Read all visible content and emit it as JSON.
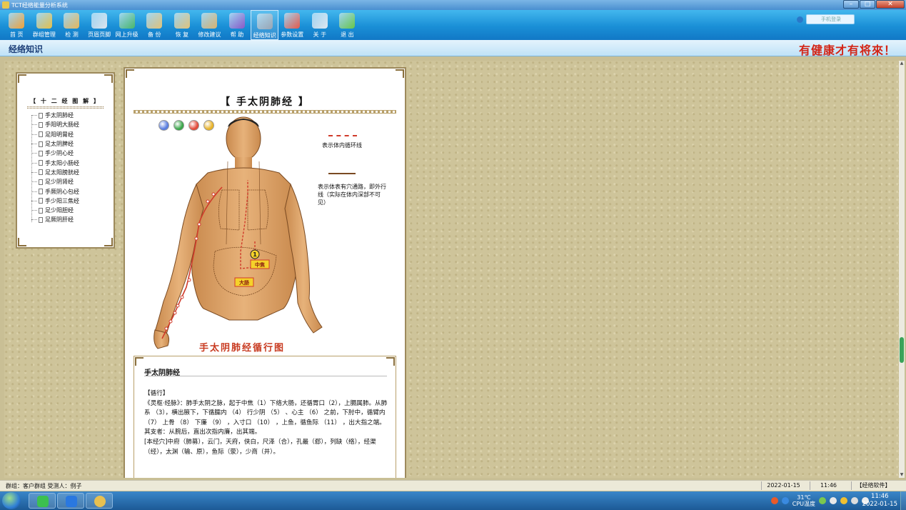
{
  "window": {
    "title": "TCT经络能量分析系统"
  },
  "toolbar": {
    "items": [
      {
        "label": "首 页",
        "icon": "home-icon",
        "color": "#f2a33a"
      },
      {
        "label": "群组管理",
        "icon": "group-icon",
        "color": "#e6c14a"
      },
      {
        "label": "检 测",
        "icon": "hand-icon",
        "color": "#e8b85a"
      },
      {
        "label": "页眉页脚",
        "icon": "page-icon",
        "color": "#dfe6ee"
      },
      {
        "label": "网上升级",
        "icon": "upgrade-icon",
        "color": "#4ab86a"
      },
      {
        "label": "备 份",
        "icon": "backup-icon",
        "color": "#e2c47a"
      },
      {
        "label": "恢 复",
        "icon": "restore-icon",
        "color": "#e2c47a"
      },
      {
        "label": "修改建议",
        "icon": "suggest-icon",
        "color": "#d9b470"
      },
      {
        "label": "帮 助",
        "icon": "help-icon",
        "color": "#8a5ac8"
      },
      {
        "label": "经络知识",
        "icon": "knowledge-icon",
        "color": "#9aa6b4"
      },
      {
        "label": "参数设置",
        "icon": "settings-icon",
        "color": "#e85a4a"
      },
      {
        "label": "关 于",
        "icon": "about-icon",
        "color": "#e0e8f0"
      },
      {
        "label": "退 出",
        "icon": "exit-icon",
        "color": "#6ac84a"
      }
    ],
    "login_text": "手机登录"
  },
  "page": {
    "title": "经络知识",
    "slogan": "有健康才有将來！"
  },
  "tree": {
    "heading": "【 十 二 经 图 解 】",
    "items": [
      "手太阴肺经",
      "手阳明大肠经",
      "足阳明胃经",
      "足太阴脾经",
      "手少阴心经",
      "手太阳小肠经",
      "足太阳膀胱经",
      "足少阴肾经",
      "手厥阴心包经",
      "手少阳三焦经",
      "足少阳胆经",
      "足厥阴肝经"
    ]
  },
  "content": {
    "title": "【   手太阴肺经   】",
    "legend_dashed": "表示体内循环线",
    "legend_solid": "表示体表有穴通路，即外行线（实际在体内深部不可见）",
    "label_zhongjiao": "中焦",
    "label_dachang": "大肠",
    "marker_number": "1",
    "caption": "手太阴肺经循行图",
    "text_heading": "手太阴肺经",
    "text_section": "【循行】",
    "text_para1": "《灵枢·经脉》：肺手太阴之脉，起于中焦（1）下络大肠，还循胃口（2），上膈属肺。从肺系 （3），横出腋下，下循臑内 （4） 行少阴 （5） 、心主 （6） 之前，下肘中，循臂内 （7） 上骨 （8） 下廉 （9） ，入寸口 （10） ，上鱼，循鱼际 （11） ，出大指之端。",
    "text_para2": "其支者：从腕后，直出次指内廉，出其端。",
    "text_para3": "[本经穴]中府（肺募），云门，天府，侠白，尺泽（合），孔最（郄），列缺（络），经渠（经），太渊（输、原），鱼际（荥），少商（井）。"
  },
  "status": {
    "left": "群组：客户群组    受测人：例子",
    "date": "2022-01-15",
    "time": "11:46",
    "brand": "【经络软件】"
  },
  "taskbar": {
    "temp": "31℃",
    "temp_label": "CPU温度",
    "clock_time": "11:46",
    "clock_date": "2022-01-15"
  }
}
